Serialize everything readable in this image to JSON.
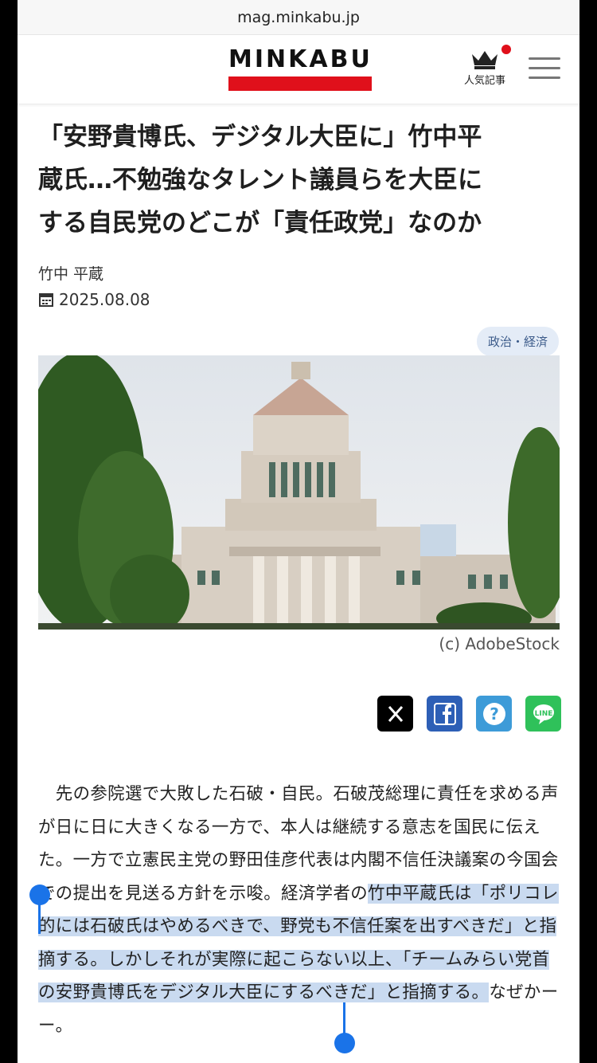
{
  "browser": {
    "url": "mag.minkabu.jp"
  },
  "header": {
    "logo": "MINKABU",
    "ranking_label": "人気記事"
  },
  "article": {
    "title_lines": [
      "「安野貴博氏、デジタル大臣に」竹中平",
      "蔵氏…不勉強なタレント議員らを大臣に",
      "する自民党のどこが「責任政党」なのか"
    ],
    "author": "竹中 平蔵",
    "date": "2025.08.08",
    "category": "政治・経済",
    "image_credit": "(c) AdobeStock",
    "body_plain": "　先の参院選で大敗した石破・自民。石破茂総理に責任を求める声が日に日に大きくなる一方で、本人は継続する意志を国民に伝えた。一方で立憲民主党の野田佳彦代表は内閣不信任決議案の今国会での提出を見送る方針を示唆。経済学者の",
    "body_selected": "竹中平蔵氏は「ポリコレ的には石破氏はやめるべきで、野党も不信任案を出すべきだ」と指摘する。しかしそれが実際に起こらない以上、「チームみらい党首の安野貴博氏をデジタル大臣にするべきだ」と指摘する。",
    "body_tail": "なぜかーー。"
  },
  "share": [
    {
      "name": "x",
      "color": "#000000"
    },
    {
      "name": "facebook",
      "color": "#2d5fb6"
    },
    {
      "name": "hatena",
      "color": "#3d9bd8"
    },
    {
      "name": "line",
      "color": "#2fc15a"
    }
  ]
}
